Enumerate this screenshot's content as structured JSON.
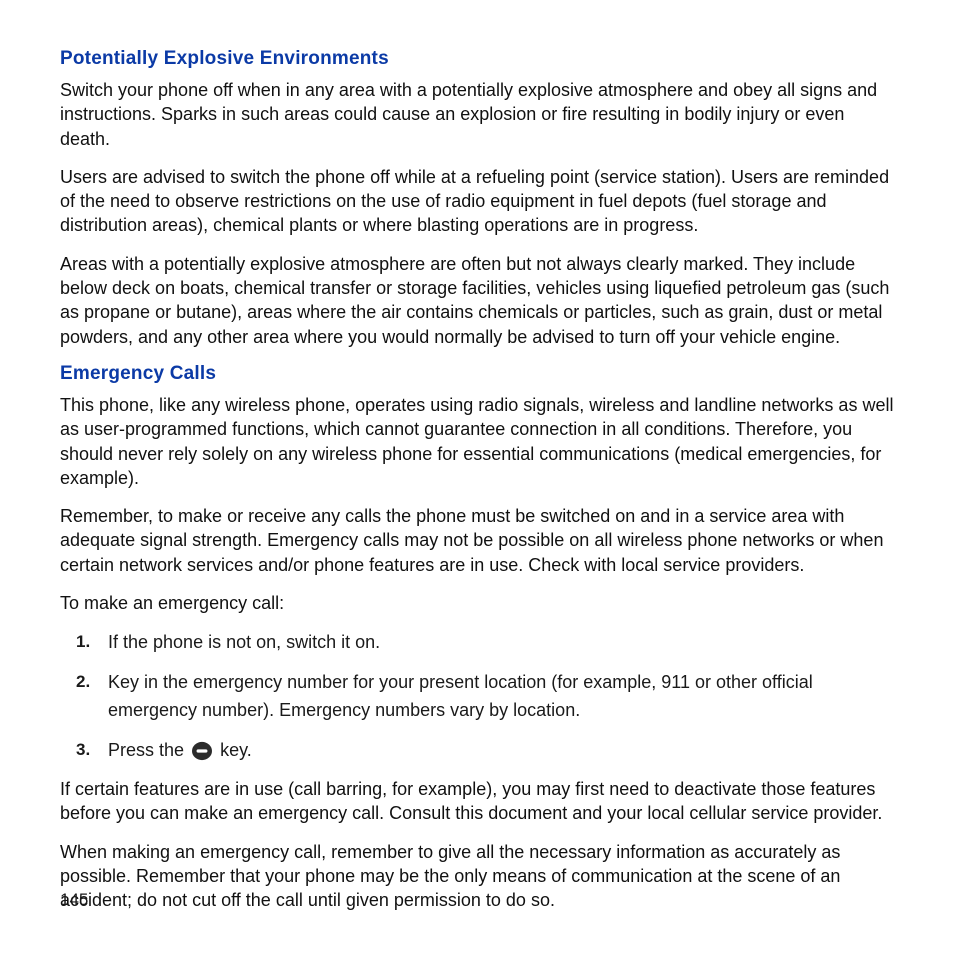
{
  "colors": {
    "heading": "#0b3aa6",
    "text": "#1a1a1a"
  },
  "section1": {
    "title": "Potentially Explosive Environments",
    "p1": "Switch your phone off when in any area with a potentially explosive atmosphere and obey all signs and instructions. Sparks in such areas could cause an explosion or fire resulting in bodily injury or even death.",
    "p2": "Users are advised to switch the phone off while at a refueling point (service station). Users are reminded of the need to observe restrictions on the use of radio equipment in fuel depots (fuel storage and distribution areas), chemical plants or where blasting operations are in progress.",
    "p3": "Areas with a potentially explosive atmosphere are often but not always clearly marked. They include below deck on boats, chemical transfer or storage facilities, vehicles using liquefied petroleum gas (such as propane or butane), areas where the air contains chemicals or particles, such as grain, dust or metal powders, and any other area where you would normally be advised to turn off your vehicle engine."
  },
  "section2": {
    "title": "Emergency Calls",
    "p1": "This phone, like any wireless phone, operates using radio signals, wireless and landline networks as well as user-programmed functions, which cannot guarantee connection in all conditions. Therefore, you should never rely solely on any wireless phone for essential communications (medical emergencies, for example).",
    "p2": "Remember, to make or receive any calls the phone must be switched on and in a service area with adequate signal strength. Emergency calls may not be possible on all wireless phone networks or when certain network services and/or phone features are in use. Check with local service providers.",
    "lead": "To make an emergency call:",
    "steps": [
      "If the phone is not on, switch it on.",
      "Key in the emergency number for your present location (for example, 911 or other official emergency number). Emergency numbers vary by location."
    ],
    "step3_pre": "Press the ",
    "step3_post": " key.",
    "icon_name": "end-call-key-icon",
    "p3": "If certain features are in use (call barring, for example), you may first need to deactivate those features before you can make an emergency call. Consult this document and your local cellular service provider.",
    "p4": "When making an emergency call, remember to give all the necessary information as accurately as possible. Remember that your phone may be the only means of communication at the scene of an accident; do not cut off the call until given permission to do so."
  },
  "page_number": "145"
}
